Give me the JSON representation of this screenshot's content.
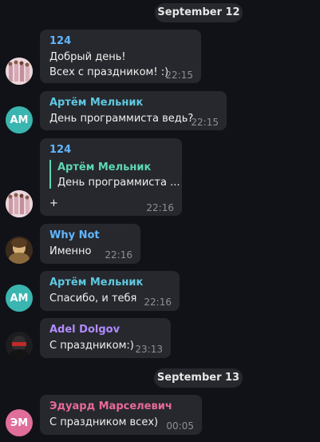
{
  "date_separators": [
    "September 12",
    "September 13"
  ],
  "messages": [
    {
      "sender": "124",
      "sender_color": "#62b6ff",
      "lines": [
        "Добрый день!",
        "Всех с праздником! :)"
      ],
      "time": "22:15",
      "avatar": "photo-pink"
    },
    {
      "sender": "Артём Мельник",
      "sender_color": "#5ec8e0",
      "lines": [
        "День программиста ведь?"
      ],
      "time": "22:15",
      "avatar": "initials",
      "initials": "AM",
      "avatar_color": "#3ab5b0"
    },
    {
      "sender": "124",
      "sender_color": "#62b6ff",
      "reply_to": {
        "sender": "Артём Мельник",
        "text": "День программиста ..."
      },
      "lines": [
        "+"
      ],
      "time": "22:16",
      "avatar": "photo-pink"
    },
    {
      "sender": "Why Not",
      "sender_color": "#62b6ff",
      "lines": [
        "Именно"
      ],
      "time": "22:16",
      "avatar": "photo-painting"
    },
    {
      "sender": "Артём Мельник",
      "sender_color": "#5ec8e0",
      "lines": [
        "Спасибо, и тебя"
      ],
      "time": "22:16",
      "avatar": "initials",
      "initials": "AM",
      "avatar_color": "#3ab5b0"
    },
    {
      "sender": "Adel Dolgov",
      "sender_color": "#b28bff",
      "lines": [
        "С праздником:)"
      ],
      "time": "23:13",
      "avatar": "photo-dark"
    },
    {
      "sender": "Эдуард Марселевич",
      "sender_color": "#e86a98",
      "lines": [
        "С праздником всех)"
      ],
      "time": "00:05",
      "avatar": "initials",
      "initials": "ЭМ",
      "avatar_color": "#e06d9a"
    }
  ]
}
